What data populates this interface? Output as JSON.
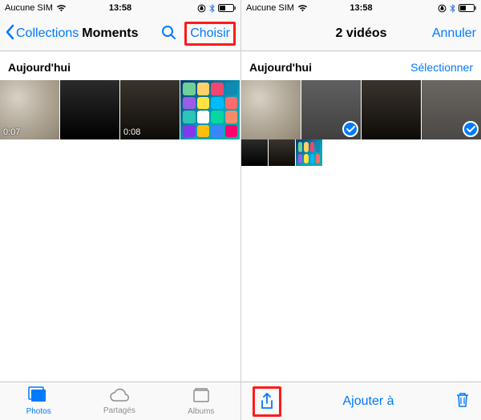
{
  "status": {
    "carrier": "Aucune SIM",
    "time": "13:58"
  },
  "left_screen": {
    "navbar": {
      "back_label": "Collections",
      "title": "Moments",
      "choose_label": "Choisir"
    },
    "section": {
      "title": "Aujourd'hui"
    },
    "items": [
      {
        "kind": "video",
        "duration": "0:07"
      },
      {
        "kind": "video",
        "duration": ""
      },
      {
        "kind": "video",
        "duration": "0:08"
      },
      {
        "kind": "homescreen"
      }
    ],
    "tabs": {
      "photos": "Photos",
      "shared": "Partagés",
      "albums": "Albums"
    }
  },
  "right_screen": {
    "navbar": {
      "title": "2 vidéos",
      "cancel_label": "Annuler"
    },
    "section": {
      "title": "Aujourd'hui",
      "select_label": "Sélectionner"
    },
    "items": [
      {
        "kind": "video",
        "selected": false
      },
      {
        "kind": "video",
        "selected": true
      },
      {
        "kind": "video",
        "selected": false
      },
      {
        "kind": "video",
        "selected": true
      }
    ],
    "toolbar": {
      "add_to_label": "Ajouter à"
    }
  },
  "icons": {
    "wifi": "wifi-icon",
    "bluetooth": "bluetooth-icon",
    "lock": "orientation-lock-icon",
    "battery": "battery-icon",
    "search": "search-icon",
    "chevron_left": "chevron-left-icon",
    "share": "share-icon",
    "trash": "trash-icon",
    "photos_tab": "photos-tab-icon",
    "cloud": "cloud-icon",
    "albums": "albums-icon"
  }
}
